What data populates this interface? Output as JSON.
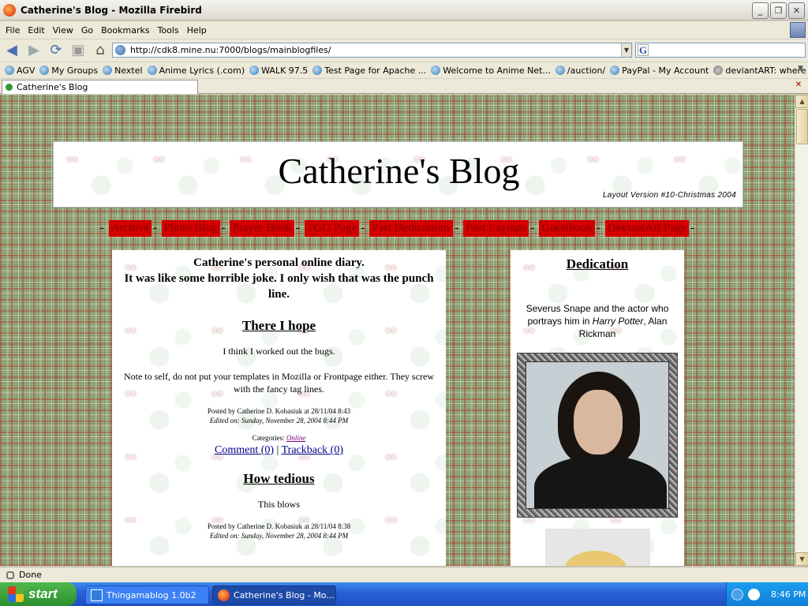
{
  "window": {
    "title": "Catherine's Blog - Mozilla Firebird"
  },
  "menu": [
    "File",
    "Edit",
    "View",
    "Go",
    "Bookmarks",
    "Tools",
    "Help"
  ],
  "address": {
    "url": "http://cdk8.mine.nu:7000/blogs/mainblogfiles/"
  },
  "bookmarks": [
    "AGV",
    "My Groups",
    "Nextel",
    "Anime Lyrics (.com)",
    "WALK 97.5",
    "Test Page for Apache ...",
    "Welcome to Anime Net...",
    "/auction/",
    "PayPal - My Account",
    "deviantART: where A..."
  ],
  "tab": {
    "label": "Catherine's Blog"
  },
  "blog": {
    "title": "Catherine's Blog",
    "layout_version": "Layout Version #10-Christmas 2004",
    "nav": [
      "Archive",
      "Photo Blog",
      "Prayer Book",
      "TGG Page",
      "Past Dedications",
      "Past Layouts",
      "Guestbook",
      "DeviantArt Page"
    ],
    "intro_line1": "Catherine's personal online diary.",
    "intro_line2": "It was like some horrible joke. I only wish that was the punch line.",
    "posts": [
      {
        "title": "There I hope",
        "p1": "I think I worked out the bugs.",
        "p2": "Note to self, do not put your templates in Mozilla or Frontpage either. They screw with the fancy tag lines.",
        "posted": "Posted by Catherine D. Kobasiuk at 28/11/04 8:43",
        "edited": "Edited on: Sunday, November 28, 2004 8:44 PM",
        "categories_label": "Categories: ",
        "category": "Online",
        "comment": "Comment (0)",
        "trackback": "Trackback (0)"
      },
      {
        "title": "How tedious",
        "p1": "This blows",
        "posted": "Posted by Catherine D. Kobasiuk at 28/11/04 8:38",
        "edited": "Edited on: Sunday, November 28, 2004 8:44 PM"
      }
    ],
    "dedication": {
      "title": "Dedication",
      "text_before": "Severus Snape and the actor who portrays him in ",
      "text_italic": "Harry Potter",
      "text_after": ", Alan Rickman"
    }
  },
  "status": {
    "text": "Done"
  },
  "taskbar": {
    "start": "start",
    "tasks": [
      "Thingamablog 1.0b2",
      "Catherine's Blog - Mo..."
    ],
    "clock": "8:46 PM"
  }
}
